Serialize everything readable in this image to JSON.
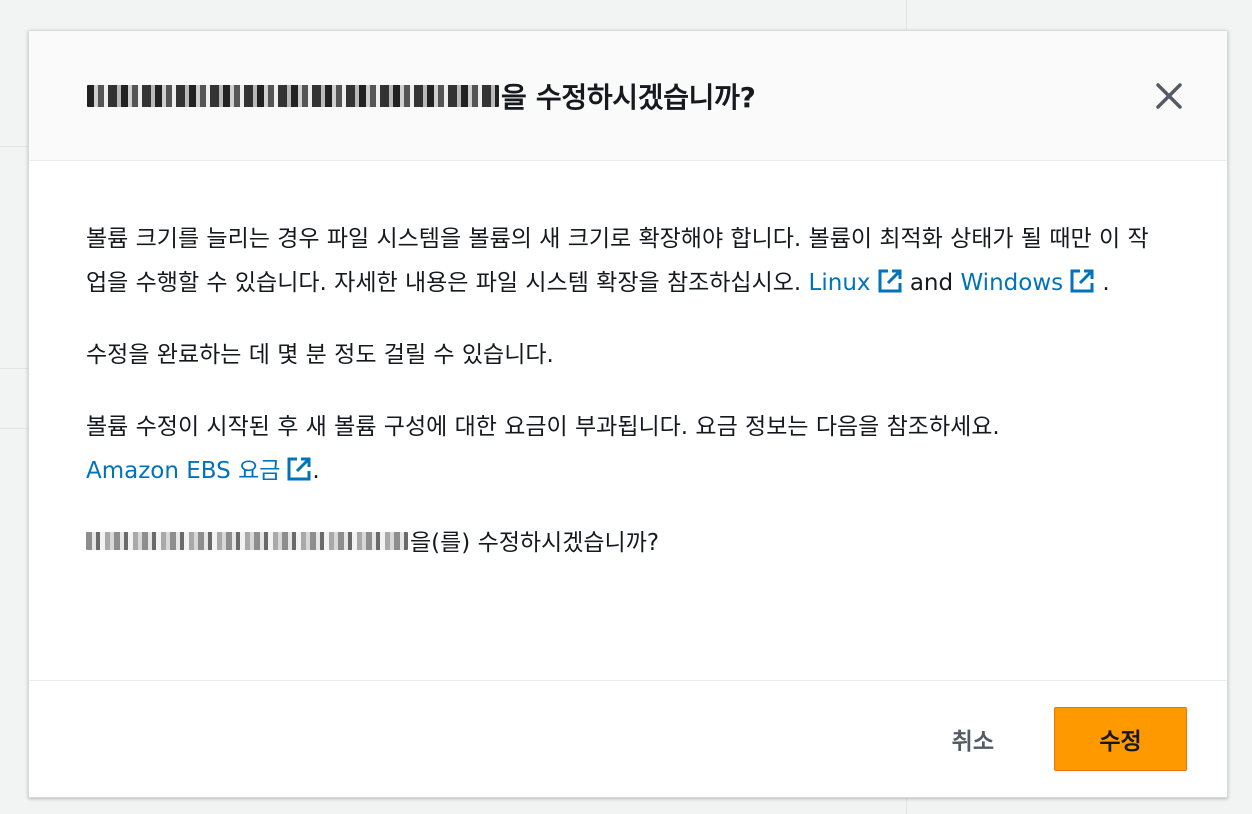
{
  "dialog": {
    "title_suffix": "을 수정하시겠습니까?",
    "close_icon": "close-icon",
    "paragraphs": {
      "p1_text": "볼륨 크기를 늘리는 경우 파일 시스템을 볼륨의 새 크기로 확장해야 합니다. 볼륨이 최적화 상태가 될 때만 이 작업을 수행할 수 있습니다. 자세한 내용은 파일 시스템 확장을 참조하십시오. ",
      "p1_link_linux": "Linux",
      "p1_and": " and ",
      "p1_link_windows": "Windows",
      "p1_end": " .",
      "p2_text": "수정을 완료하는 데 몇 분 정도 걸릴 수 있습니다.",
      "p3_text": "볼륨 수정이 시작된 후 새 볼륨 구성에 대한 요금이 부과됩니다. 요금 정보는 다음을 참조하세요. ",
      "p3_link": "Amazon EBS 요금",
      "p3_end": ".",
      "p4_suffix": "을(를) 수정하시겠습니까?"
    },
    "footer": {
      "cancel_label": "취소",
      "confirm_label": "수정"
    },
    "colors": {
      "link": "#0073bb",
      "primary_button": "#ff9900"
    },
    "icons": {
      "external_link": "external-link-icon"
    }
  }
}
